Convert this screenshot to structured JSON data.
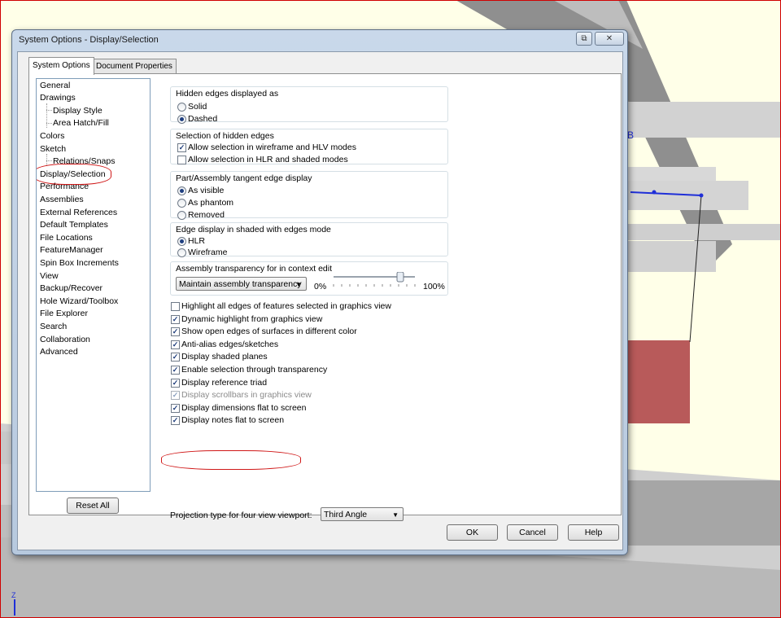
{
  "window": {
    "title": "System Options - Display/Selection",
    "restore_glyph": "⧉",
    "close_glyph": "✕"
  },
  "tabs": [
    {
      "label": "System Options",
      "active": true
    },
    {
      "label": "Document Properties",
      "active": false
    }
  ],
  "tree": {
    "items": [
      {
        "label": "General",
        "child": false
      },
      {
        "label": "Drawings",
        "child": false
      },
      {
        "label": "Display Style",
        "child": true
      },
      {
        "label": "Area Hatch/Fill",
        "child": true
      },
      {
        "label": "Colors",
        "child": false
      },
      {
        "label": "Sketch",
        "child": false
      },
      {
        "label": "Relations/Snaps",
        "child": true
      },
      {
        "label": "Display/Selection",
        "child": false,
        "selected": true
      },
      {
        "label": "Performance",
        "child": false
      },
      {
        "label": "Assemblies",
        "child": false
      },
      {
        "label": "External References",
        "child": false
      },
      {
        "label": "Default Templates",
        "child": false
      },
      {
        "label": "File Locations",
        "child": false
      },
      {
        "label": "FeatureManager",
        "child": false
      },
      {
        "label": "Spin Box Increments",
        "child": false
      },
      {
        "label": "View",
        "child": false
      },
      {
        "label": "Backup/Recover",
        "child": false
      },
      {
        "label": "Hole Wizard/Toolbox",
        "child": false
      },
      {
        "label": "File Explorer",
        "child": false
      },
      {
        "label": "Search",
        "child": false
      },
      {
        "label": "Collaboration",
        "child": false
      },
      {
        "label": "Advanced",
        "child": false
      }
    ],
    "reset_label": "Reset All"
  },
  "groups": {
    "hidden_edges": {
      "label": "Hidden edges displayed as",
      "options": [
        {
          "label": "Solid",
          "selected": false
        },
        {
          "label": "Dashed",
          "selected": true
        }
      ]
    },
    "selection_hidden": {
      "label": "Selection of hidden edges",
      "options": [
        {
          "label": "Allow selection in wireframe and HLV modes",
          "checked": true
        },
        {
          "label": "Allow selection in HLR and shaded modes",
          "checked": false
        }
      ]
    },
    "tangent": {
      "label": "Part/Assembly tangent edge display",
      "options": [
        {
          "label": "As visible",
          "selected": true
        },
        {
          "label": "As phantom",
          "selected": false
        },
        {
          "label": "Removed",
          "selected": false
        }
      ]
    },
    "edge_shaded": {
      "label": "Edge display in shaded with edges mode",
      "options": [
        {
          "label": "HLR",
          "selected": true
        },
        {
          "label": "Wireframe",
          "selected": false
        }
      ]
    },
    "transparency": {
      "label": "Assembly transparency for in context edit",
      "combo_value": "Maintain assembly transparency",
      "min_label": "0%",
      "max_label": "100%",
      "slider_value": 0.82
    }
  },
  "checkboxes": [
    {
      "label": "Highlight all edges of features selected in graphics view",
      "checked": false,
      "enabled": true
    },
    {
      "label": "Dynamic highlight from graphics view",
      "checked": true,
      "enabled": true
    },
    {
      "label": "Show open edges of surfaces in different color",
      "checked": true,
      "enabled": true
    },
    {
      "label": "Anti-alias edges/sketches",
      "checked": true,
      "enabled": true
    },
    {
      "label": "Display shaded planes",
      "checked": true,
      "enabled": true
    },
    {
      "label": "Enable selection through transparency",
      "checked": true,
      "enabled": true
    },
    {
      "label": "Display reference triad",
      "checked": true,
      "enabled": true
    },
    {
      "label": "Display scrollbars in graphics view",
      "checked": true,
      "enabled": false
    },
    {
      "label": "Display dimensions flat to screen",
      "checked": true,
      "enabled": true
    },
    {
      "label": "Display notes flat to screen",
      "checked": true,
      "enabled": true
    }
  ],
  "projection": {
    "label": "Projection type for four view viewport:",
    "value": "Third Angle"
  },
  "buttons": {
    "ok": "OK",
    "cancel": "Cancel",
    "help": "Help"
  },
  "scene": {
    "triad_label": "Z",
    "stray_label": "B",
    "colors": {
      "metal": "#c8c8c8",
      "red_block": "#b85a5a",
      "blue_sketch": "#1f2fd8",
      "highlight": "#d01818"
    }
  }
}
